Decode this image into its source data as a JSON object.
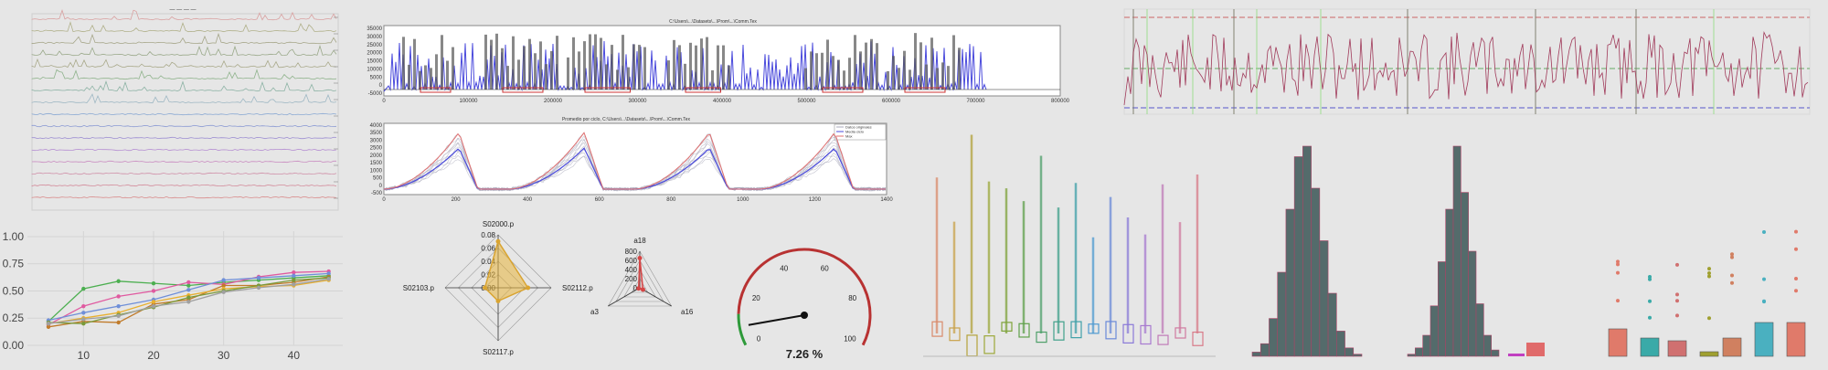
{
  "colors": {
    "background": "#e6e6e6",
    "blue_trace": "#4b4bdc",
    "red_line": "#e07070",
    "gauge_needle": "#111111",
    "gauge_green": "#2e9a3a",
    "gauge_red": "#b83232",
    "radar_fill": "#e8b43c",
    "radar_small": "#d64545",
    "hist_fill": "#546b6b"
  },
  "panels": {
    "stacked_traces": {
      "title": "— — — —"
    },
    "spectrum_plot": {
      "title": "C:\\Users\\...\\Datasets\\...\\Prom\\...\\Comm.Tex",
      "yticks": [
        "35000",
        "30000",
        "25000",
        "20000",
        "15000",
        "10000",
        "5000",
        "0",
        "-5000"
      ],
      "xticks": [
        "0",
        "100000",
        "200000",
        "300000",
        "400000",
        "500000",
        "600000",
        "700000",
        "800000"
      ]
    },
    "mean_profiles": {
      "title": "Promedio por ciclo, C:\\Users\\...\\Datasets\\...\\Prom\\...\\Comm.Tex",
      "legend": [
        "Datos originales",
        "Media ciclo",
        "Max"
      ],
      "yticks": [
        "4000",
        "3500",
        "3000",
        "2500",
        "2000",
        "1500",
        "1000",
        "500",
        "0",
        "-500"
      ],
      "xticks": [
        "0",
        "200",
        "400",
        "600",
        "800",
        "1000",
        "1200",
        "1400"
      ]
    },
    "timeseries_dense": {},
    "boxplot_many": {},
    "histograms": {},
    "boxplot_colored": {}
  },
  "chart_data": [
    {
      "type": "line",
      "id": "multi_line",
      "x": [
        5,
        10,
        15,
        20,
        25,
        30,
        35,
        40,
        45
      ],
      "xticks": [
        "10",
        "20",
        "30",
        "40"
      ],
      "yticks": [
        "1.00",
        "0.75",
        "0.50",
        "0.25",
        "0.00"
      ],
      "ylim": [
        0,
        1.05
      ],
      "xlim": [
        2,
        47
      ],
      "series": [
        {
          "color": "#4caf50",
          "values": [
            0.22,
            0.52,
            0.59,
            0.57,
            0.55,
            0.58,
            0.6,
            0.62,
            0.64
          ]
        },
        {
          "color": "#e05aa0",
          "values": [
            0.19,
            0.36,
            0.45,
            0.5,
            0.58,
            0.56,
            0.63,
            0.67,
            0.68
          ]
        },
        {
          "color": "#6f8fd8",
          "values": [
            0.23,
            0.3,
            0.36,
            0.42,
            0.51,
            0.6,
            0.62,
            0.64,
            0.66
          ]
        },
        {
          "color": "#c07b2b",
          "values": [
            0.17,
            0.22,
            0.21,
            0.38,
            0.42,
            0.55,
            0.55,
            0.58,
            0.63
          ]
        },
        {
          "color": "#e8b030",
          "values": [
            0.2,
            0.25,
            0.3,
            0.4,
            0.46,
            0.52,
            0.54,
            0.55,
            0.6
          ]
        },
        {
          "color": "#7a9a3a",
          "values": [
            0.21,
            0.2,
            0.28,
            0.35,
            0.44,
            0.5,
            0.55,
            0.6,
            0.62
          ]
        },
        {
          "color": "#a0a0a0",
          "values": [
            0.2,
            0.24,
            0.27,
            0.36,
            0.4,
            0.49,
            0.53,
            0.56,
            0.61
          ]
        }
      ]
    },
    {
      "type": "radar",
      "id": "radar_large",
      "axes": [
        "S02000.p",
        "S02112.p",
        "S02117.p",
        "S02103.p"
      ],
      "rticks": [
        "0.08",
        "0.06",
        "0.04",
        "0.02",
        "0.00"
      ],
      "rmax": 0.08,
      "values": [
        0.07,
        0.045,
        0.02,
        0.02
      ]
    },
    {
      "type": "radar",
      "id": "radar_small",
      "axes": [
        "a18",
        "a16",
        "a3"
      ],
      "rticks": [
        "800",
        "600",
        "400",
        "200",
        "0"
      ],
      "rmax": 800,
      "values": [
        650,
        80,
        30
      ]
    },
    {
      "type": "gauge",
      "id": "gauge",
      "min": 0,
      "max": 100,
      "ticks": [
        "0",
        "20",
        "40",
        "60",
        "80",
        "100"
      ],
      "value": 7.26,
      "value_label": "7.26 %"
    },
    {
      "type": "histogram",
      "id": "hist_a",
      "values": [
        2,
        6,
        18,
        40,
        70,
        95,
        100,
        80,
        55,
        30,
        12,
        4,
        1
      ]
    },
    {
      "type": "histogram",
      "id": "hist_b",
      "values": [
        1,
        4,
        10,
        24,
        45,
        70,
        100,
        78,
        50,
        25,
        10,
        3
      ]
    }
  ]
}
